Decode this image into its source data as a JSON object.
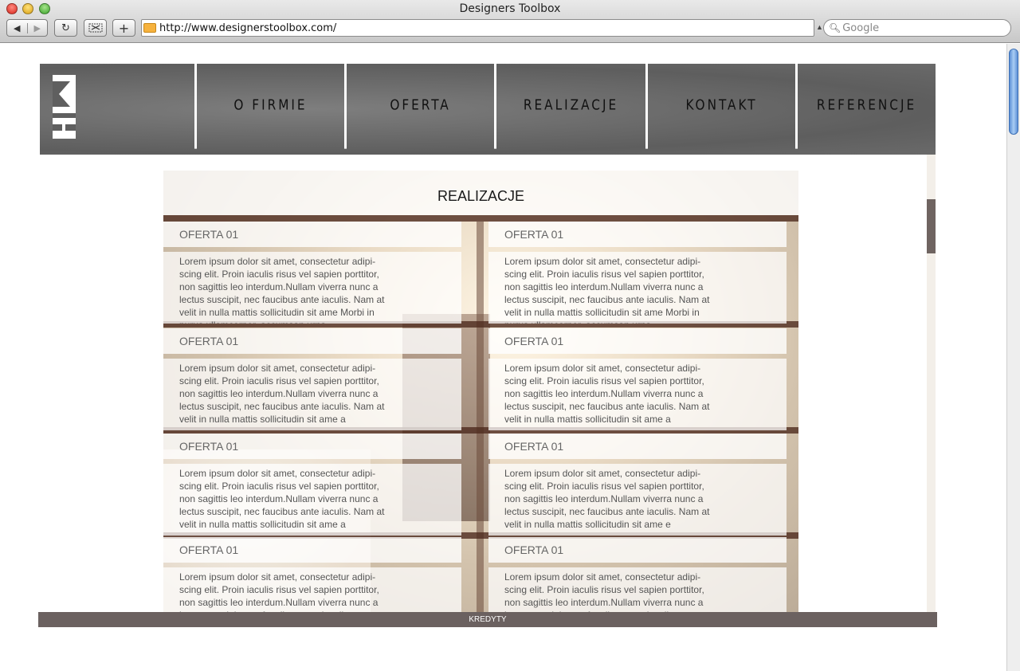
{
  "browser": {
    "window_title": "Designers Toolbox",
    "url": "http://www.designerstoolbox.com/",
    "search_placeholder": "Google",
    "back_glyph": "◀",
    "forward_glyph": "▶",
    "reload_glyph": "↻",
    "add_glyph": "+"
  },
  "nav": {
    "items": [
      "O FIRMIE",
      "OFERTA",
      "REALIZACJE",
      "KONTAKT",
      "REFERENCJE"
    ]
  },
  "section": {
    "title": "REALIZACJE",
    "offers": [
      {
        "title": "OFERTA 01",
        "text": "Lorem ipsum dolor sit amet, consectetur adipi-scing elit. Proin iaculis risus vel sapien porttitor, non sagittis leo interdum.Nullam viverra nunc a lectus suscipit, nec faucibus ante iaculis. Nam at velit in nulla mattis sollicitudin sit ame Morbi in purus ullamcorper, accumsan urna"
      },
      {
        "title": "OFERTA 01",
        "text": "Lorem ipsum dolor sit amet, consectetur adipi-scing elit. Proin iaculis risus vel sapien porttitor, non sagittis leo interdum.Nullam viverra nunc a lectus suscipit, nec faucibus ante iaculis. Nam at velit in nulla mattis sollicitudin sit ame Morbi in purus ullamcorper, accumsan urna"
      },
      {
        "title": "OFERTA 01",
        "text": "Lorem ipsum dolor sit amet, consectetur adipi-scing elit. Proin iaculis risus vel sapien porttitor, non sagittis leo interdum.Nullam viverra nunc a lectus suscipit, nec faucibus ante iaculis. Nam at velit in nulla mattis sollicitudin sit ame a"
      },
      {
        "title": "OFERTA 01",
        "text": "Lorem ipsum dolor sit amet, consectetur adipi-scing elit. Proin iaculis risus vel sapien porttitor, non sagittis leo interdum.Nullam viverra nunc a lectus suscipit, nec faucibus ante iaculis. Nam at velit in nulla mattis sollicitudin sit ame a"
      },
      {
        "title": "OFERTA 01",
        "text": "Lorem ipsum dolor sit amet, consectetur adipi-scing elit. Proin iaculis risus vel sapien porttitor, non sagittis leo interdum.Nullam viverra nunc a lectus suscipit, nec faucibus ante iaculis. Nam at velit in nulla mattis sollicitudin sit ame a"
      },
      {
        "title": "OFERTA 01",
        "text": "Lorem ipsum dolor sit amet, consectetur adipi-scing elit. Proin iaculis risus vel sapien porttitor, non sagittis leo interdum.Nullam viverra nunc a lectus suscipit, nec faucibus ante iaculis. Nam at velit in nulla mattis sollicitudin sit ame e"
      },
      {
        "title": "OFERTA 01",
        "text": "Lorem ipsum dolor sit amet, consectetur adipi-scing elit. Proin iaculis risus vel sapien porttitor, non sagittis leo interdum.Nullam viverra nunc a lectus suscipit, nec faucibus ante iaculis."
      },
      {
        "title": "OFERTA 01",
        "text": "Lorem ipsum dolor sit amet, consectetur adipi-scing elit. Proin iaculis risus vel sapien porttitor, non sagittis leo interdum.Nullam viverra nunc a lectus suscipit, nec faucibus ante iaculis."
      }
    ]
  },
  "footer": {
    "label": "KREDYTY"
  },
  "colors": {
    "header_bg": "#6a6a6a",
    "footer_bg": "#6b6160",
    "scroll_thumb": "#6f6461",
    "stripe": "#4d2b1e"
  }
}
